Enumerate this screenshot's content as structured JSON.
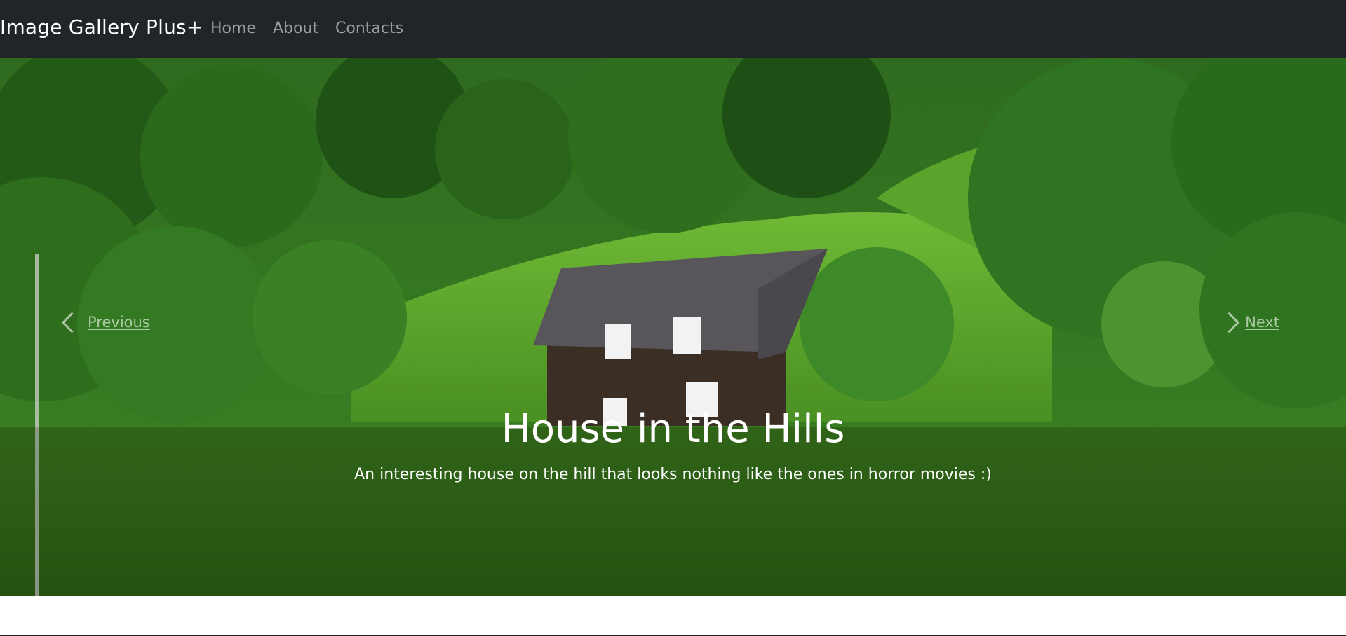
{
  "navbar": {
    "brand": "Image Gallery Plus+",
    "links": [
      {
        "label": "Home"
      },
      {
        "label": "About"
      },
      {
        "label": "Contacts"
      }
    ]
  },
  "carousel": {
    "slide": {
      "title": "House in the Hills",
      "description": "An interesting house on the hill that looks nothing like the ones in horror movies :)"
    },
    "prev_label": "Previous",
    "next_label": "Next"
  },
  "colors": {
    "navbar_bg": "#212529",
    "nav_link": "rgba(255,255,255,0.55)",
    "brand": "#ffffff"
  }
}
